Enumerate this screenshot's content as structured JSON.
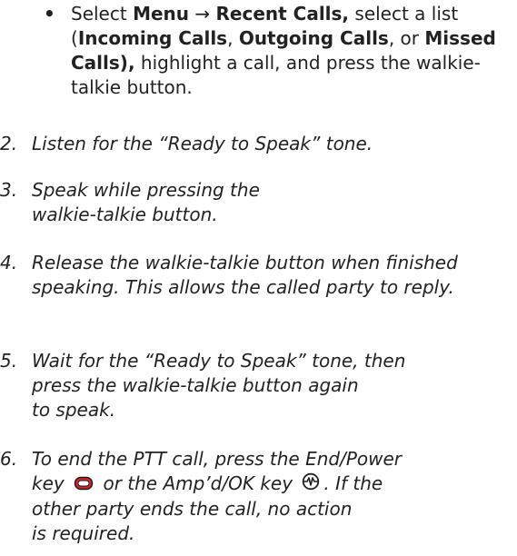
{
  "bullet": {
    "symbol": "•",
    "t1": "Select ",
    "menu": "Menu",
    "arrow": " → ",
    "recent": "Recent Calls,",
    "t2": " select a list (",
    "incoming": "Incoming Calls",
    "sep1": ", ",
    "outgoing": "Outgoing Calls",
    "t3": ", or ",
    "missed": "Missed Calls",
    "t4": "),",
    "t5": " highlight a call, and press the walkie-talkie button."
  },
  "steps": [
    {
      "num": "2.",
      "text": "Listen for the “Ready to Speak” tone."
    },
    {
      "num": "3.",
      "line1": "Speak while pressing the",
      "line2": "walkie-talkie button."
    },
    {
      "num": "4.",
      "text": "Release the walkie-talkie button when finished speaking. This allows the called party to reply."
    },
    {
      "num": "5.",
      "line1": "Wait for the “Ready to Speak” tone, then",
      "line2": "press the walkie-talkie button again",
      "line3": "to speak."
    },
    {
      "num": "6.",
      "line1": "To end the PTT call, press the End/Power",
      "key1_pre": "key",
      "key1_mid": " or the Amp’d/OK key ",
      "key2_post": ". If the",
      "line3": "other party ends the call, no action",
      "line4": "is required."
    }
  ],
  "colors": {
    "end_key": "#d9232e",
    "ok_key": "#222222"
  },
  "icons": {
    "end_key": "end-power-key-icon",
    "ok_key": "ampd-ok-key-icon"
  }
}
